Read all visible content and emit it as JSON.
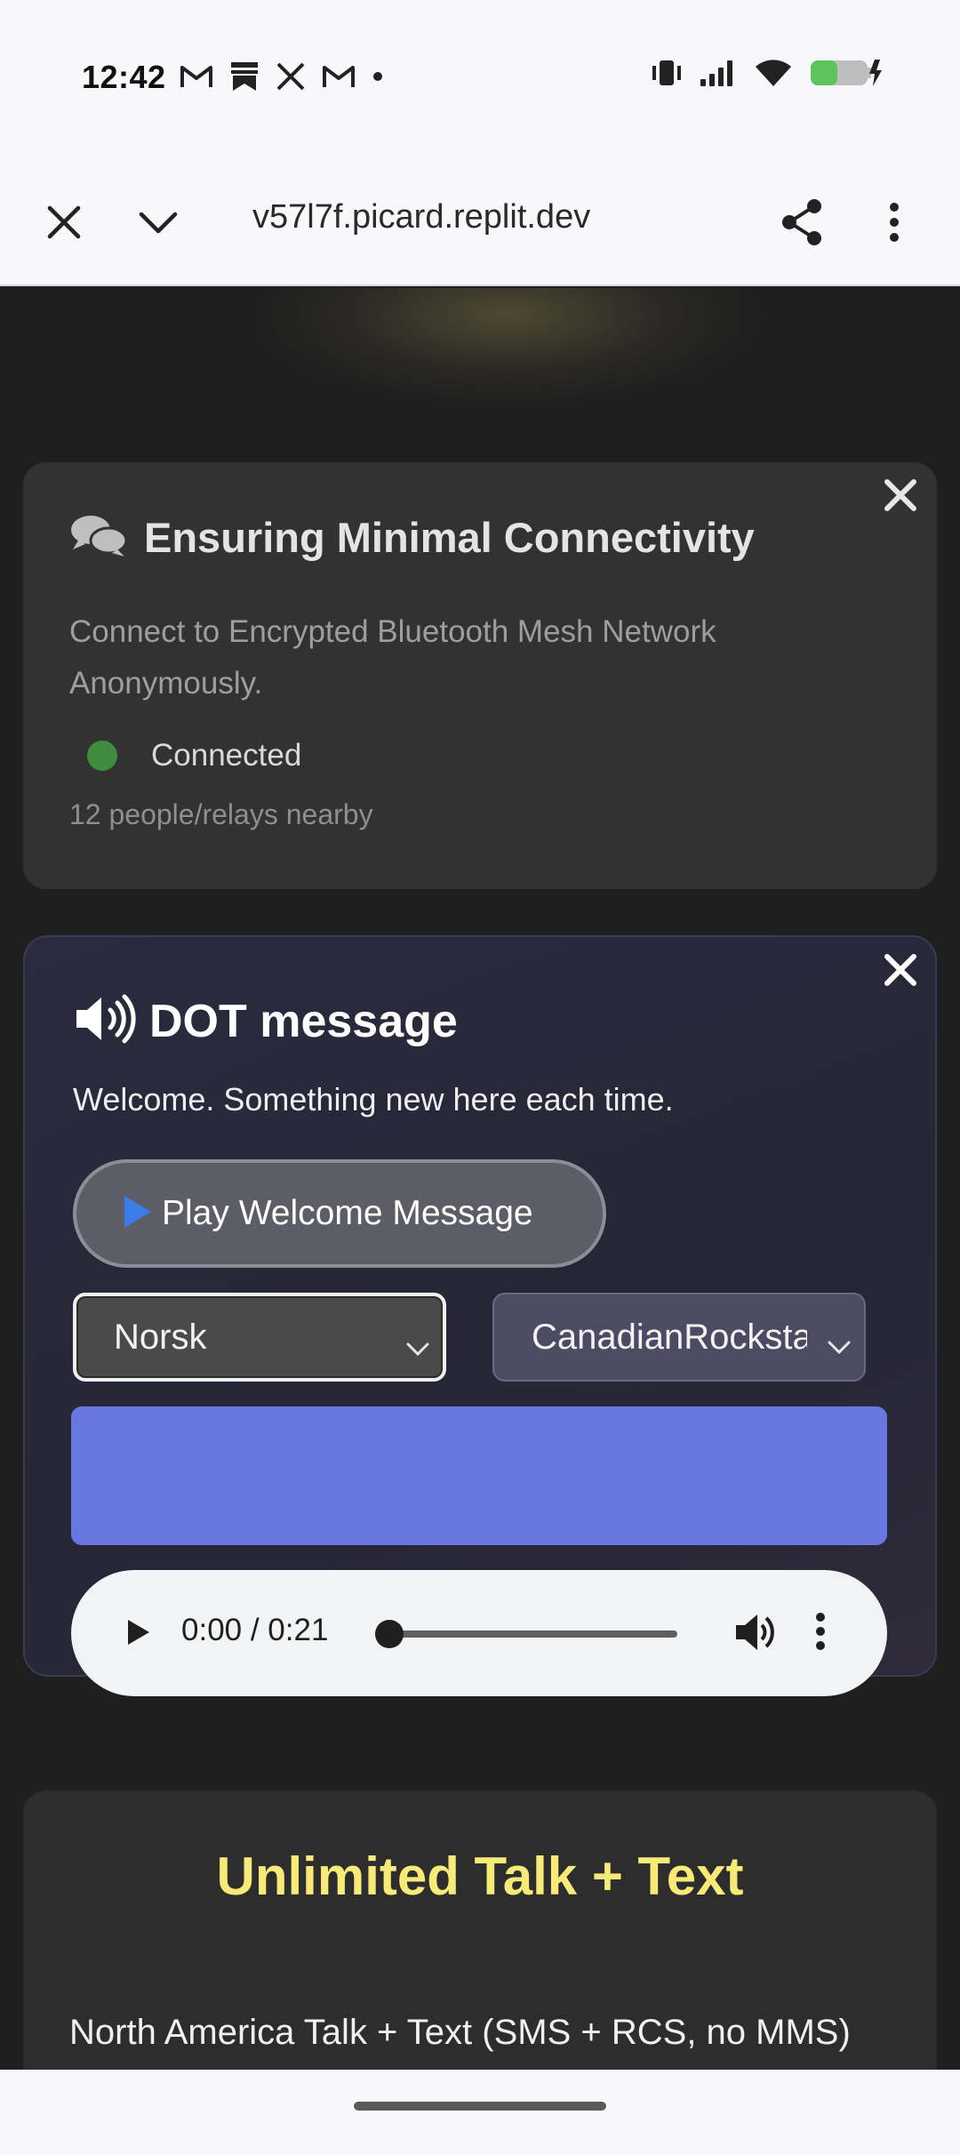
{
  "status_bar": {
    "time": "12:42",
    "left_icons": [
      "gmail-icon",
      "bookmark-icon",
      "x-icon",
      "gmail-icon",
      "dot-icon"
    ],
    "right_icons": [
      "vibrate-icon",
      "signal-icon",
      "wifi-icon",
      "battery-charging-icon"
    ]
  },
  "browser": {
    "url": "v57l7f.picard.replit.dev"
  },
  "connectivity_card": {
    "title": "Ensuring Minimal Connectivity",
    "description": "Connect to Encrypted Bluetooth Mesh Network Anonymously.",
    "status": "Connected",
    "status_color": "#3f8c3f",
    "nearby": "12 people/relays nearby"
  },
  "dot_card": {
    "title": "DOT message",
    "description": "Welcome. Something new here each time.",
    "play_button": "Play Welcome Message",
    "language_select": "Norsk",
    "voice_select": "CanadianRockstar",
    "accent_color": "#6677e2",
    "audio": {
      "time": "0:00 / 0:21",
      "progress": 0.0
    }
  },
  "plan_card": {
    "title": "Unlimited Talk + Text",
    "subtitle": "North America Talk + Text (SMS + RCS, no MMS)"
  }
}
